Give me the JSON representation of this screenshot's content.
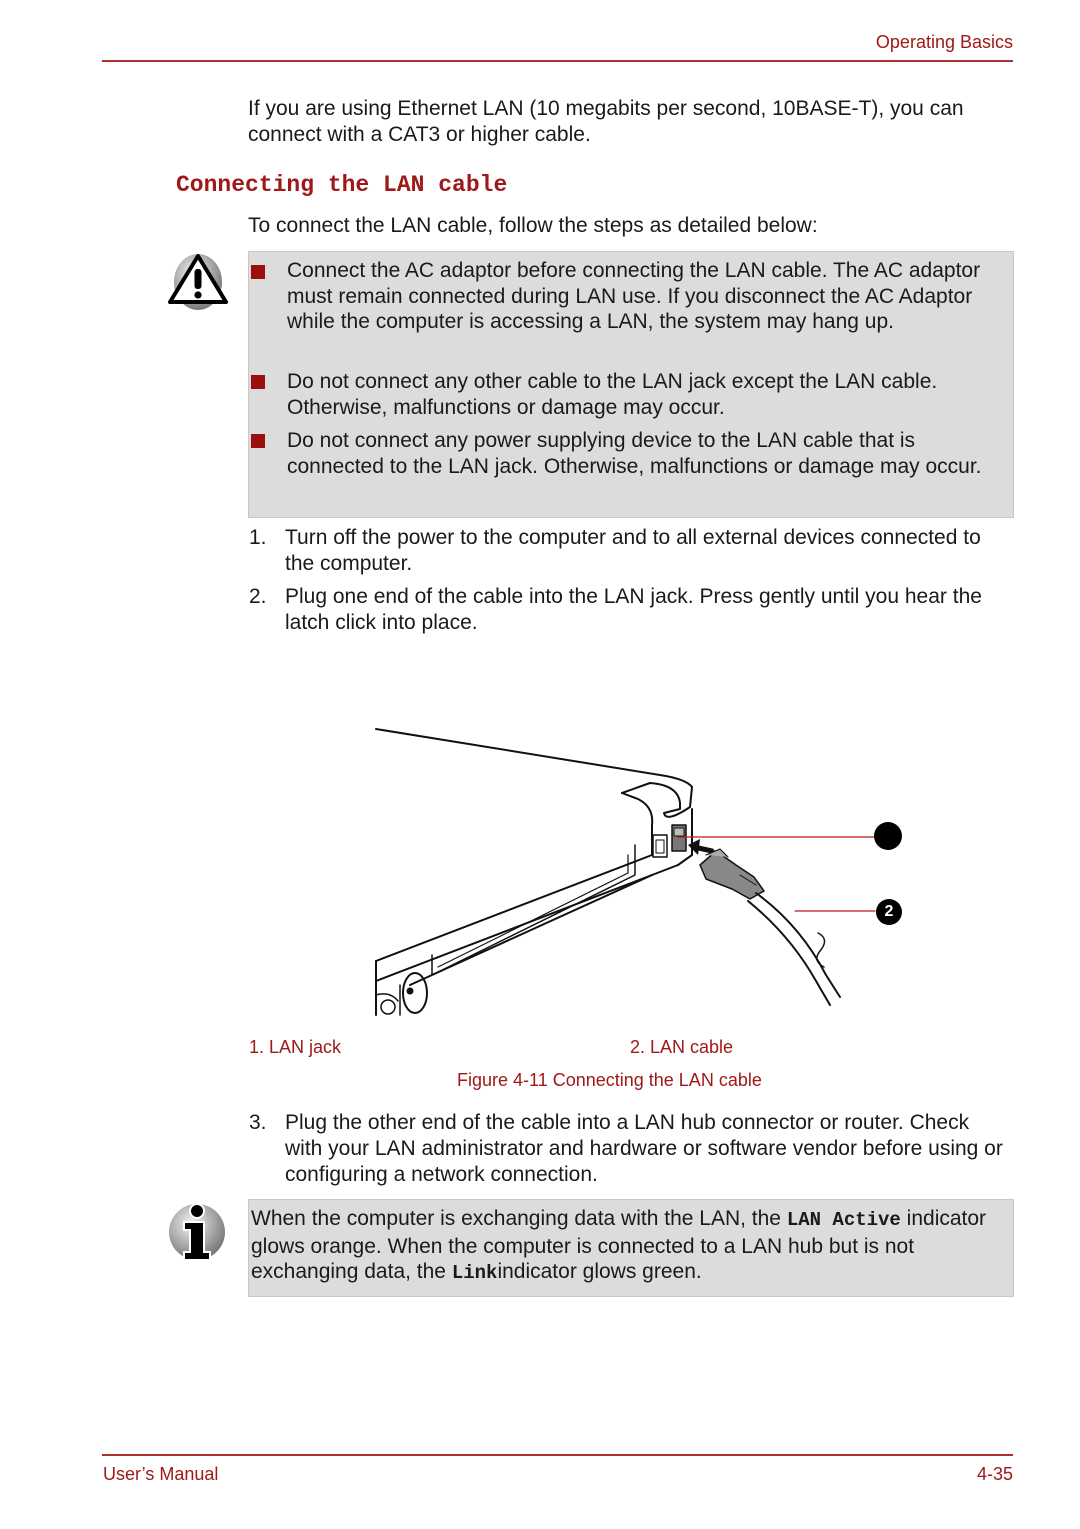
{
  "header": {
    "section": "Operating Basics"
  },
  "intro": "If you are using Ethernet LAN (10 megabits per second, 10BASE-T), you can connect with a CAT3 or higher cable.",
  "heading": "Connecting the LAN cable",
  "lead": "To connect the LAN cable, follow the steps as detailed below:",
  "caution": {
    "icon": "warning-icon",
    "items": [
      "Connect the AC adaptor before connecting the LAN cable. The AC adaptor must remain connected during LAN use. If you disconnect the AC Adaptor while the computer is accessing a LAN, the system may hang up.",
      "Do not connect any other cable to the LAN jack except the LAN cable. Otherwise, malfunctions or damage may occur.",
      "Do not connect any power supplying device to the LAN cable that is connected to the LAN jack. Otherwise, malfunctions or damage may occur."
    ]
  },
  "steps_a": [
    {
      "num": "1.",
      "text": "Turn off the power to the computer and to all external devices connected to the computer."
    },
    {
      "num": "2.",
      "text": "Plug one end of the cable into the LAN jack. Press gently until you hear the latch click into place."
    }
  ],
  "figure": {
    "callouts": [
      "",
      "2"
    ],
    "legend": [
      "1. LAN jack",
      "2. LAN cable"
    ],
    "caption": "Figure 4-11 Connecting the LAN cable"
  },
  "steps_b": [
    {
      "num": "3.",
      "text": "Plug the other end of the cable into a LAN hub connector or router. Check with your LAN administrator and hardware or software vendor before using or configuring a network connection."
    }
  ],
  "info": {
    "icon": "info-icon",
    "t1": "When the computer is exchanging data with the LAN, the ",
    "code1": "LAN Active",
    "t2": " indicator glows orange. When the computer is connected to a LAN hub but is not exchanging data, the ",
    "code2": "Link",
    "t3": "indicator glows green."
  },
  "footer": {
    "left": "User’s Manual",
    "right": "4-35"
  }
}
